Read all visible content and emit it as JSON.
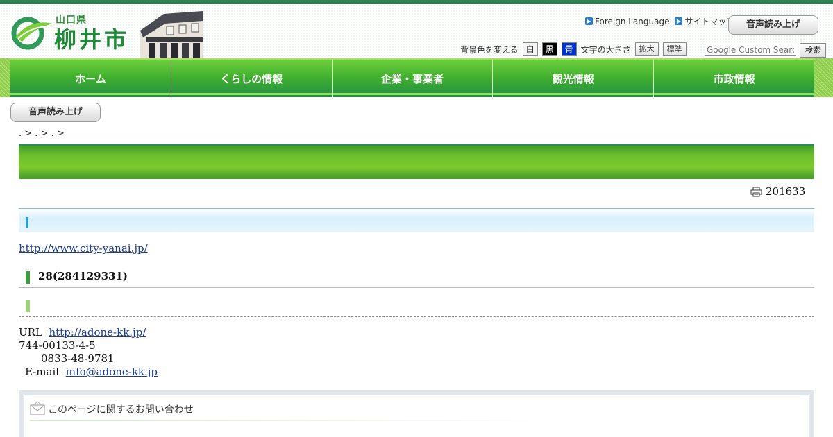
{
  "header": {
    "logo_pref": "山口県",
    "logo_city": "柳井市",
    "util_links": [
      "Foreign Language",
      "サイトマップ"
    ],
    "voice_button": "音声読み上げ",
    "bg_color_label": "背景色を変える",
    "color_options": [
      "白",
      "黒",
      "青"
    ],
    "text_size_label": "文字の大きさ",
    "size_options": [
      "拡大",
      "標準"
    ],
    "search_placeholder": "Google Custom Search",
    "search_button": "検索"
  },
  "nav": {
    "items": [
      "ホーム",
      "くらしの情報",
      "企業・事業者",
      "観光情報",
      "市政情報"
    ]
  },
  "content": {
    "voice_button": "音声読み上げ",
    "breadcrumb": ". > . > . >",
    "print_text": "201633",
    "link_city": "http://www.city-yanai.jp/",
    "heading": "28(284129331)",
    "info_url_label": "URL",
    "info_url": "http://adone-kk.jp/",
    "info_address": "744-00133-4-5",
    "info_tel": "0833-48-9781",
    "info_email_label": "E-mail",
    "info_email": "info@adone-kk.jp",
    "contact_title": "このページに関するお問い合わせ"
  },
  "colors": {
    "accent_green": "#3fae2e",
    "link_blue": "#1a3c9a",
    "top_strip": "#2f7f4f"
  }
}
